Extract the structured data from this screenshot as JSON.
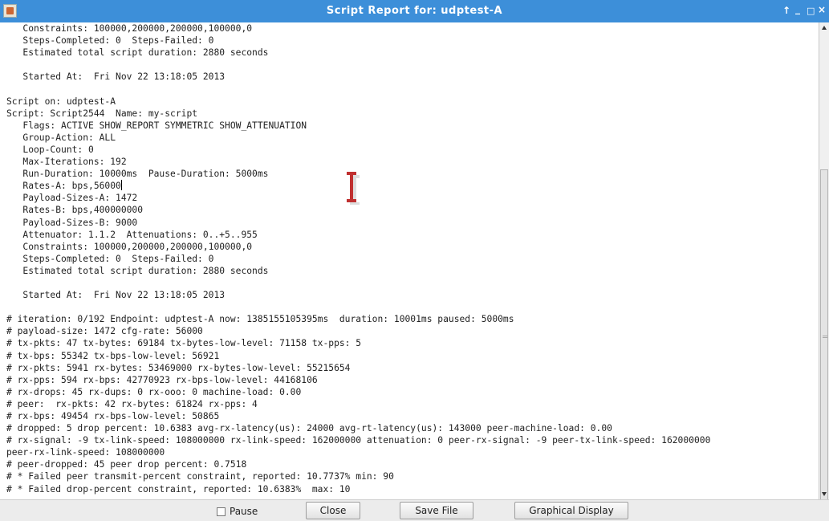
{
  "window": {
    "title": "Script Report for:  udptest-A",
    "controls": [
      "↑",
      "_",
      "□",
      "×"
    ]
  },
  "report": {
    "caret_after_line": 14,
    "lines": [
      "   Constraints: 100000,200000,200000,100000,0",
      "   Steps-Completed: 0  Steps-Failed: 0",
      "   Estimated total script duration: 2880 seconds",
      "",
      "   Started At:  Fri Nov 22 13:18:05 2013",
      "",
      "Script on: udptest-A",
      "Script: Script2544  Name: my-script",
      "   Flags: ACTIVE SHOW_REPORT SYMMETRIC SHOW_ATTENUATION",
      "   Group-Action: ALL",
      "   Loop-Count: 0",
      "   Max-Iterations: 192",
      "   Run-Duration: 10000ms  Pause-Duration: 5000ms",
      "   Rates-A: bps,56000",
      "   Payload-Sizes-A: 1472",
      "   Rates-B: bps,400000000",
      "   Payload-Sizes-B: 9000",
      "   Attenuator: 1.1.2  Attenuations: 0..+5..955",
      "   Constraints: 100000,200000,200000,100000,0",
      "   Steps-Completed: 0  Steps-Failed: 0",
      "   Estimated total script duration: 2880 seconds",
      "",
      "   Started At:  Fri Nov 22 13:18:05 2013",
      "",
      "# iteration: 0/192 Endpoint: udptest-A now: 1385155105395ms  duration: 10001ms paused: 5000ms",
      "# payload-size: 1472 cfg-rate: 56000",
      "# tx-pkts: 47 tx-bytes: 69184 tx-bytes-low-level: 71158 tx-pps: 5",
      "# tx-bps: 55342 tx-bps-low-level: 56921",
      "# rx-pkts: 5941 rx-bytes: 53469000 rx-bytes-low-level: 55215654",
      "# rx-pps: 594 rx-bps: 42770923 rx-bps-low-level: 44168106",
      "# rx-drops: 45 rx-dups: 0 rx-ooo: 0 machine-load: 0.00",
      "# peer:  rx-pkts: 42 rx-bytes: 61824 rx-pps: 4",
      "# rx-bps: 49454 rx-bps-low-level: 50865",
      "# dropped: 5 drop percent: 10.6383 avg-rx-latency(us): 24000 avg-rt-latency(us): 143000 peer-machine-load: 0.00",
      "# rx-signal: -9 tx-link-speed: 108000000 rx-link-speed: 162000000 attenuation: 0 peer-rx-signal: -9 peer-tx-link-speed: 162000000",
      "peer-rx-link-speed: 108000000",
      "# peer-dropped: 45 peer drop percent: 0.7518",
      "# * Failed peer transmit-percent constraint, reported: 10.7737% min: 90",
      "# * Failed drop-percent constraint, reported: 10.6383%  max: 10"
    ]
  },
  "buttons": {
    "pause_label": "Pause",
    "pause_checked": false,
    "close_label": "Close",
    "save_label": "Save File",
    "graph_label": "Graphical Display"
  },
  "colors": {
    "titlebar": "#3d8fd9",
    "ibeam": "#c03030"
  }
}
